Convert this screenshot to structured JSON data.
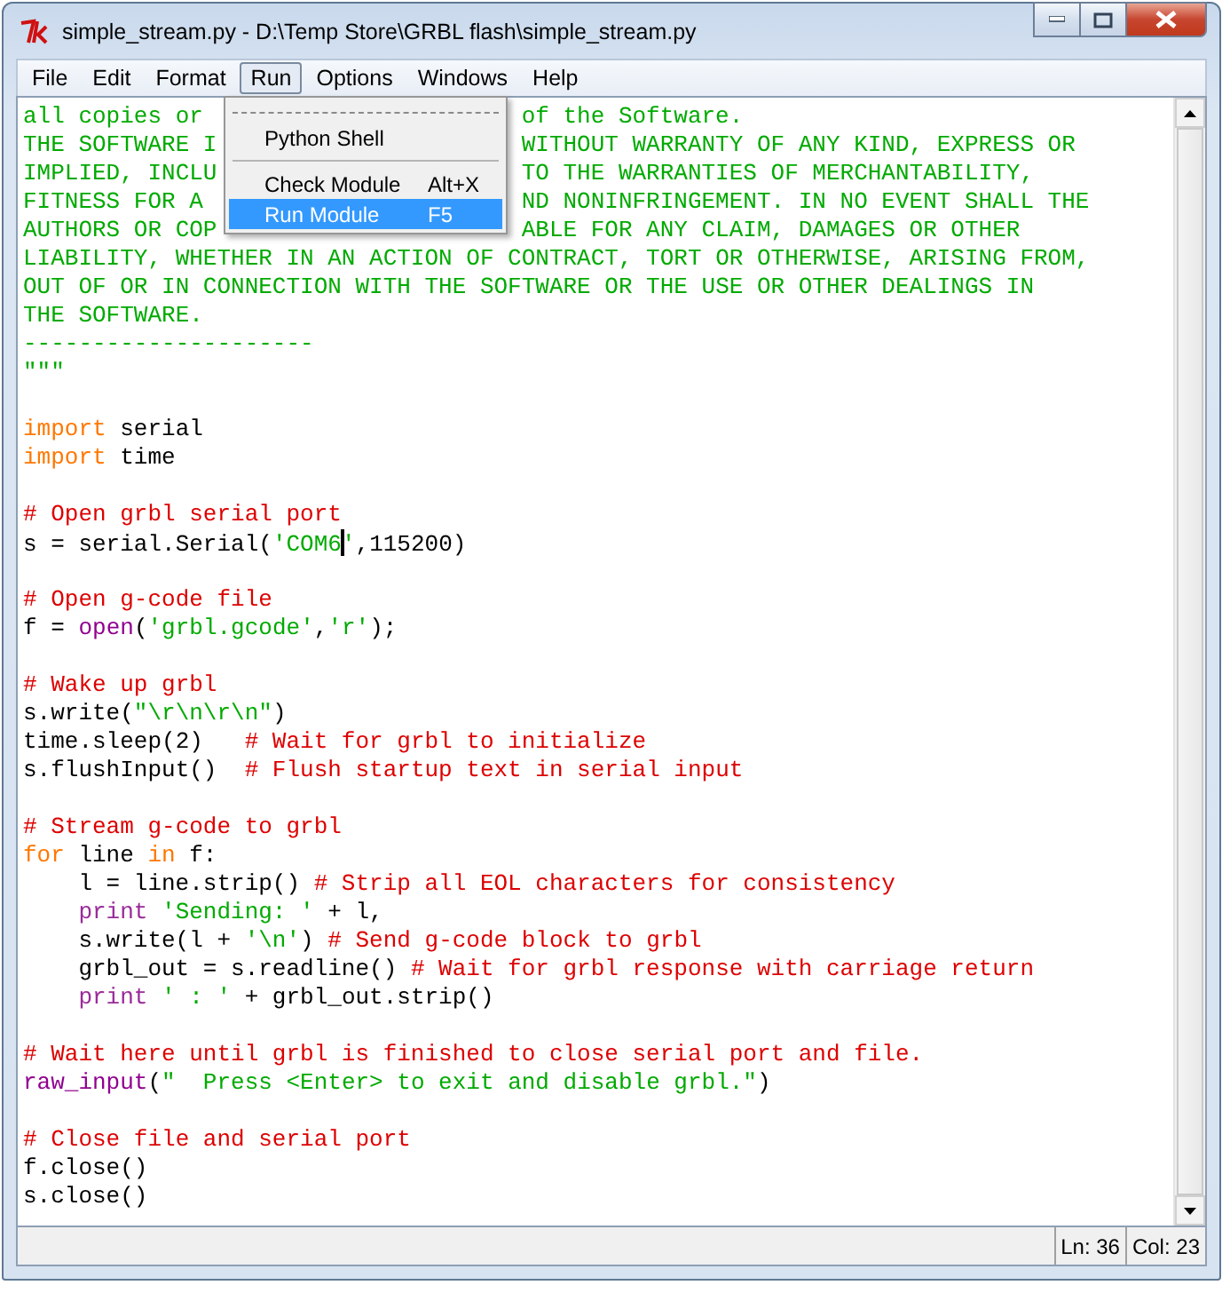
{
  "window": {
    "title": "simple_stream.py - D:\\Temp Store\\GRBL flash\\simple_stream.py"
  },
  "menu_bar": [
    {
      "label": "File",
      "selected": false
    },
    {
      "label": "Edit",
      "selected": false
    },
    {
      "label": "Format",
      "selected": false
    },
    {
      "label": "Run",
      "selected": true
    },
    {
      "label": "Options",
      "selected": false
    },
    {
      "label": "Windows",
      "selected": false
    },
    {
      "label": "Help",
      "selected": false
    }
  ],
  "run_menu": {
    "items": [
      {
        "kind": "tearoff"
      },
      {
        "kind": "item",
        "label": "Python Shell",
        "selected": false
      },
      {
        "kind": "separator"
      },
      {
        "kind": "item",
        "label": "Check Module",
        "shortcut": "Alt+X",
        "selected": false
      },
      {
        "kind": "item",
        "label": "Run Module",
        "shortcut": "F5",
        "selected": true
      }
    ]
  },
  "editor": {
    "lines": [
      {
        "kind": "covered",
        "left": "all copies or",
        "right": "of the Software."
      },
      {
        "kind": "covered",
        "left": "THE SOFTWARE I",
        "right": "WITHOUT WARRANTY OF ANY KIND, EXPRESS OR"
      },
      {
        "kind": "covered",
        "left": "IMPLIED, INCLU",
        "right": "TO THE WARRANTIES OF MERCHANTABILITY,"
      },
      {
        "kind": "covered",
        "left": "FITNESS FOR A",
        "right": "ND NONINFRINGEMENT. IN NO EVENT SHALL THE"
      },
      {
        "kind": "covered",
        "left": "AUTHORS OR COP",
        "right": "ABLE FOR ANY CLAIM, DAMAGES OR OTHER"
      },
      {
        "kind": "code",
        "segments": [
          {
            "kind": "string",
            "text": "LIABILITY, WHETHER IN AN ACTION OF CONTRACT, TORT OR OTHERWISE, ARISING FROM,"
          }
        ]
      },
      {
        "kind": "code",
        "segments": [
          {
            "kind": "string",
            "text": "OUT OF OR IN CONNECTION WITH THE SOFTWARE OR THE USE OR OTHER DEALINGS IN"
          }
        ]
      },
      {
        "kind": "code",
        "segments": [
          {
            "kind": "string",
            "text": "THE SOFTWARE."
          }
        ]
      },
      {
        "kind": "code",
        "segments": [
          {
            "kind": "string",
            "text": "---------------------"
          }
        ]
      },
      {
        "kind": "code",
        "segments": [
          {
            "kind": "string",
            "text": "\"\"\""
          }
        ]
      },
      {
        "kind": "blank"
      },
      {
        "kind": "code",
        "segments": [
          {
            "kind": "keyword",
            "text": "import"
          },
          {
            "kind": "plain",
            "text": " serial"
          }
        ]
      },
      {
        "kind": "code",
        "segments": [
          {
            "kind": "keyword",
            "text": "import"
          },
          {
            "kind": "plain",
            "text": " time"
          }
        ]
      },
      {
        "kind": "blank"
      },
      {
        "kind": "code",
        "segments": [
          {
            "kind": "comment",
            "text": "# Open grbl serial port"
          }
        ]
      },
      {
        "kind": "code",
        "segments": [
          {
            "kind": "plain",
            "text": "s = serial.Serial("
          },
          {
            "kind": "string",
            "text": "'COM6",
            "caret": true
          },
          {
            "kind": "string",
            "text": "'"
          },
          {
            "kind": "plain",
            "text": ",115200)"
          }
        ]
      },
      {
        "kind": "blank"
      },
      {
        "kind": "code",
        "segments": [
          {
            "kind": "comment",
            "text": "# Open g-code file"
          }
        ]
      },
      {
        "kind": "code",
        "segments": [
          {
            "kind": "plain",
            "text": "f = "
          },
          {
            "kind": "builtin",
            "text": "open"
          },
          {
            "kind": "plain",
            "text": "("
          },
          {
            "kind": "string",
            "text": "'grbl.gcode'"
          },
          {
            "kind": "plain",
            "text": ","
          },
          {
            "kind": "string",
            "text": "'r'"
          },
          {
            "kind": "plain",
            "text": ");"
          }
        ]
      },
      {
        "kind": "blank"
      },
      {
        "kind": "code",
        "segments": [
          {
            "kind": "comment",
            "text": "# Wake up grbl"
          }
        ]
      },
      {
        "kind": "code",
        "segments": [
          {
            "kind": "plain",
            "text": "s.write("
          },
          {
            "kind": "string",
            "text": "\"\\r\\n\\r\\n\""
          },
          {
            "kind": "plain",
            "text": ")"
          }
        ]
      },
      {
        "kind": "code",
        "segments": [
          {
            "kind": "plain",
            "text": "time.sleep(2)   "
          },
          {
            "kind": "comment",
            "text": "# Wait for grbl to initialize"
          }
        ]
      },
      {
        "kind": "code",
        "segments": [
          {
            "kind": "plain",
            "text": "s.flushInput()  "
          },
          {
            "kind": "comment",
            "text": "# Flush startup text in serial input"
          }
        ]
      },
      {
        "kind": "blank"
      },
      {
        "kind": "code",
        "segments": [
          {
            "kind": "comment",
            "text": "# Stream g-code to grbl"
          }
        ]
      },
      {
        "kind": "code",
        "segments": [
          {
            "kind": "keyword",
            "text": "for"
          },
          {
            "kind": "plain",
            "text": " line "
          },
          {
            "kind": "keyword",
            "text": "in"
          },
          {
            "kind": "plain",
            "text": " f:"
          }
        ]
      },
      {
        "kind": "code",
        "indent": true,
        "segments": [
          {
            "kind": "plain",
            "text": "l = line.strip() "
          },
          {
            "kind": "comment",
            "text": "# Strip all EOL characters for consistency"
          }
        ]
      },
      {
        "kind": "code",
        "indent": true,
        "segments": [
          {
            "kind": "keyword-print",
            "text": "print"
          },
          {
            "kind": "string",
            "text": " 'Sending: '"
          },
          {
            "kind": "plain",
            "text": " + l,"
          }
        ]
      },
      {
        "kind": "code",
        "indent": true,
        "segments": [
          {
            "kind": "plain",
            "text": "s.write(l + "
          },
          {
            "kind": "string",
            "text": "'\\n'"
          },
          {
            "kind": "plain",
            "text": ") "
          },
          {
            "kind": "comment",
            "text": "# Send g-code block to grbl"
          }
        ]
      },
      {
        "kind": "code",
        "indent": true,
        "segments": [
          {
            "kind": "plain",
            "text": "grbl_out = s.readline() "
          },
          {
            "kind": "comment",
            "text": "# Wait for grbl response with carriage return"
          }
        ]
      },
      {
        "kind": "code",
        "indent": true,
        "segments": [
          {
            "kind": "keyword-print",
            "text": "print"
          },
          {
            "kind": "string",
            "text": " ' : '"
          },
          {
            "kind": "plain",
            "text": " + grbl_out.strip()"
          }
        ]
      },
      {
        "kind": "blank"
      },
      {
        "kind": "code",
        "segments": [
          {
            "kind": "comment",
            "text": "# Wait here until grbl is finished to close serial port and file."
          }
        ]
      },
      {
        "kind": "code",
        "segments": [
          {
            "kind": "builtin",
            "text": "raw_input"
          },
          {
            "kind": "plain",
            "text": "("
          },
          {
            "kind": "string",
            "text": "\"  Press <Enter> to exit and disable grbl.\""
          },
          {
            "kind": "plain",
            "text": ")"
          }
        ]
      },
      {
        "kind": "blank"
      },
      {
        "kind": "code",
        "segments": [
          {
            "kind": "comment",
            "text": "# Close file and serial port"
          }
        ]
      },
      {
        "kind": "code",
        "segments": [
          {
            "kind": "plain",
            "text": "f.close()"
          }
        ]
      },
      {
        "kind": "code",
        "segments": [
          {
            "kind": "plain",
            "text": "s.close()"
          }
        ]
      }
    ]
  },
  "status_bar": {
    "line": "Ln: 36",
    "column": "Col: 23"
  }
}
